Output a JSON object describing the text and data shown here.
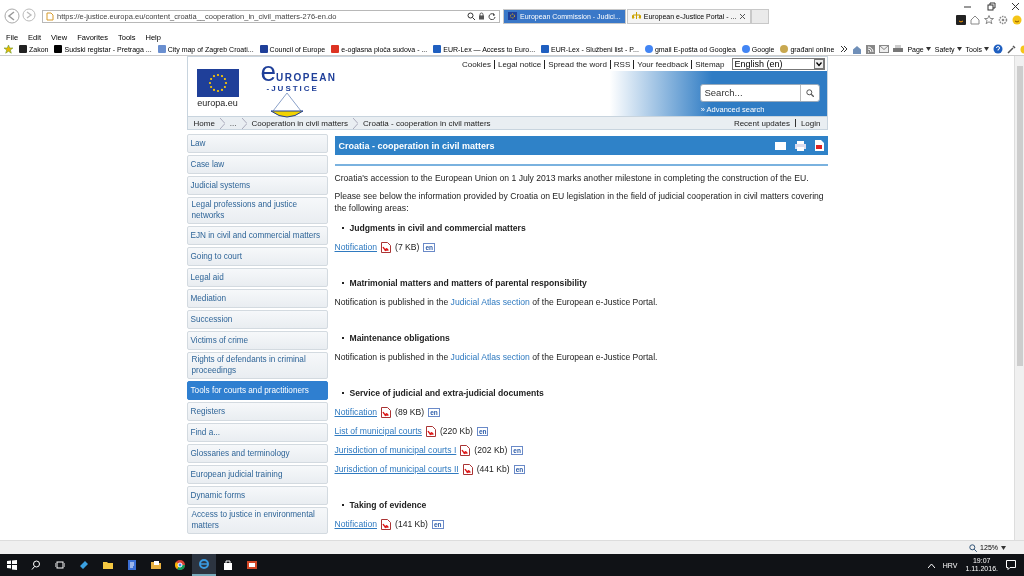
{
  "browser": {
    "address": "https://e-justice.europa.eu/content_croatia__cooperation_in_civil_matters-276-en.do",
    "tabs": [
      {
        "title": "European Commission - Judici...",
        "selected": false
      },
      {
        "title": "European e-Justice Portal - ...",
        "selected": true
      }
    ],
    "menu": [
      "File",
      "Edit",
      "View",
      "Favorites",
      "Tools",
      "Help"
    ],
    "favorites": [
      "Zakon",
      "Sudski registar - Pretraga ...",
      "City map of Zagreb Croati...",
      "Council of Europe",
      "e-oglasna ploča sudova - ...",
      "EUR-Lex — Access to Euro...",
      "EUR-Lex - Službeni list - P...",
      "gmail E-pošta od Googlea",
      "Google",
      "građani online"
    ],
    "commands": [
      "Page",
      "Safety",
      "Tools"
    ]
  },
  "page": {
    "header": {
      "europa_label": "europa.eu",
      "logo_mark": "e",
      "logo_line1": "UROPEAN",
      "logo_line2": "-JUSTICE",
      "top_links": [
        "Cookies",
        "Legal notice",
        "Spread the word",
        "RSS",
        "Your feedback",
        "Sitemap"
      ],
      "language": "English (en)",
      "search_placeholder": "Search...",
      "advanced_search": "» Advanced search"
    },
    "breadcrumb": [
      "Home",
      "...",
      "Cooperation in civil matters",
      "Croatia - cooperation in civil matters"
    ],
    "user_links": [
      "Recent updates",
      "Login"
    ],
    "sidebar": [
      {
        "label": "Law",
        "selected": false
      },
      {
        "label": "Case law",
        "selected": false
      },
      {
        "label": "Judicial systems",
        "selected": false
      },
      {
        "label": "Legal professions and justice networks",
        "selected": false
      },
      {
        "label": "EJN in civil and commercial matters",
        "selected": false
      },
      {
        "label": "Going to court",
        "selected": false
      },
      {
        "label": "Legal aid",
        "selected": false
      },
      {
        "label": "Mediation",
        "selected": false
      },
      {
        "label": "Succession",
        "selected": false
      },
      {
        "label": "Victims of crime",
        "selected": false
      },
      {
        "label": "Rights of defendants in criminal proceedings",
        "selected": false
      },
      {
        "label": "Tools for courts and practitioners",
        "selected": true
      },
      {
        "label": "Registers",
        "selected": false
      },
      {
        "label": "Find a...",
        "selected": false
      },
      {
        "label": "Glossaries and terminology",
        "selected": false
      },
      {
        "label": "European judicial training",
        "selected": false
      },
      {
        "label": "Dynamic forms",
        "selected": false
      },
      {
        "label": "Access to justice in environmental matters",
        "selected": false
      }
    ],
    "article": {
      "title": "Croatia - cooperation in civil matters",
      "paragraphs": [
        "Croatia's accession to the European Union on 1 July 2013 marks another milestone in completing the construction of the EU.",
        "Please see below the information provided by Croatia on EU legislation in the field of judicial cooperation in civil matters covering the following areas:"
      ],
      "sections": [
        {
          "heading": "Judgments in civil and commercial matters",
          "items": [
            {
              "kind": "file",
              "link": "Notification",
              "size": "(7 KB)",
              "lang": "en"
            }
          ]
        },
        {
          "heading": "Matrimonial matters and matters of parental responsibility",
          "items": [
            {
              "kind": "note",
              "before": "Notification is published in the ",
              "link": "Judicial Atlas section",
              "after": " of the European e-Justice Portal."
            }
          ]
        },
        {
          "heading": "Maintenance obligations",
          "items": [
            {
              "kind": "note",
              "before": "Notification is published in the ",
              "link": "Judicial Atlas section",
              "after": " of the European e-Justice Portal."
            }
          ]
        },
        {
          "heading": "Service of judicial and extra-judicial documents",
          "items": [
            {
              "kind": "file",
              "link": "Notification",
              "size": "(89 KB)",
              "lang": "en"
            },
            {
              "kind": "file",
              "link": "List of municipal courts",
              "size": "(220 Kb)",
              "lang": "en"
            },
            {
              "kind": "file",
              "link": "Jurisdiction of municipal courts I",
              "size": "(202 Kb)",
              "lang": "en"
            },
            {
              "kind": "file",
              "link": "Jurisdiction of municipal courts II",
              "size": "(441 Kb)",
              "lang": "en"
            }
          ]
        },
        {
          "heading": "Taking of evidence",
          "items": [
            {
              "kind": "file",
              "link": "Notification",
              "size": "(141 Kb)",
              "lang": "en"
            }
          ]
        }
      ]
    }
  },
  "status_bar": {
    "zoom": "125%"
  },
  "taskbar": {
    "language": "HRV",
    "time": "19:07",
    "date": "1.11.2016."
  }
}
